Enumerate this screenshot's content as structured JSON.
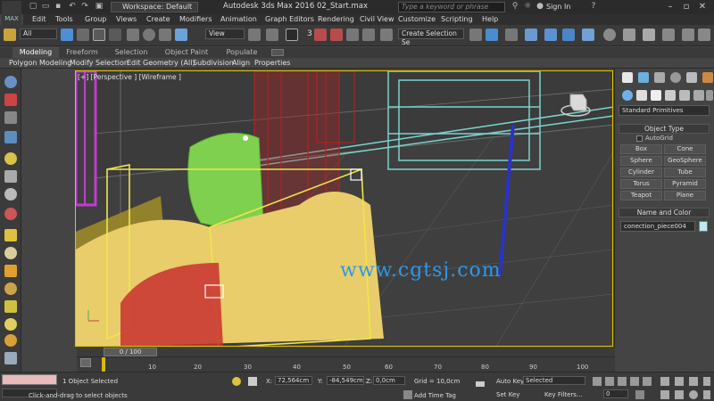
{
  "titlebar": {
    "logo": "MAX",
    "workspace": "Workspace: Default",
    "app_title": "Autodesk 3ds Max 2016     02_Start.max",
    "search_placeholder": "Type a keyword or phrase",
    "sign_in": "Sign In"
  },
  "menu": [
    "Edit",
    "Tools",
    "Group",
    "Views",
    "Create",
    "Modifiers",
    "Animation",
    "Graph Editors",
    "Rendering",
    "Civil View",
    "Customize",
    "Scripting",
    "Help"
  ],
  "toolbar": {
    "selection_filter": "All",
    "reference_coord": "View",
    "create_selection_set": "Create Selection Se",
    "angle_snap": "3"
  },
  "ribbon": {
    "tabs": [
      "Modeling",
      "Freeform",
      "Selection",
      "Object Paint",
      "Populate"
    ],
    "panels": [
      "Polygon Modeling",
      "Modify Selection",
      "Edit",
      "Geometry (All)",
      "Subdivision",
      "Align",
      "Properties"
    ]
  },
  "viewport": {
    "label": "[+] [Perspective ] [Wireframe ]",
    "watermark": "www.cgtsj.com"
  },
  "command_panel": {
    "category": "Standard Primitives",
    "object_type_title": "Object Type",
    "autogrid": "AutoGrid",
    "buttons": [
      "Box",
      "Cone",
      "Sphere",
      "GeoSphere",
      "Cylinder",
      "Tube",
      "Torus",
      "Pyramid",
      "Teapot",
      "Plane"
    ],
    "name_color_title": "Name and Color",
    "object_name": "conection_piece004",
    "object_color": "#bfe9f3"
  },
  "timeline": {
    "slider": "0 / 100",
    "ticks": [
      "10",
      "20",
      "30",
      "40",
      "50",
      "60",
      "70",
      "80",
      "90",
      "100"
    ]
  },
  "status": {
    "selection": "1 Object Selected",
    "prompt": "Click-and-drag to select objects",
    "x_label": "X:",
    "x_value": "72,564cm",
    "y_label": "Y:",
    "y_value": "-84,549cm",
    "z_label": "Z:",
    "z_value": "0,0cm",
    "grid": "Grid = 10,0cm",
    "add_time_tag": "Add Time Tag",
    "auto_key": "Auto Key",
    "set_key": "Set Key",
    "key_mode": "Selected",
    "key_filters": "Key Filters...",
    "frame": "0"
  }
}
